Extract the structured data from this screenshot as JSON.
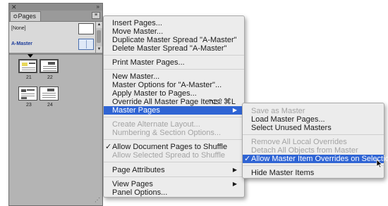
{
  "panel": {
    "tab_label": "≎Pages",
    "close_glyph": "✕",
    "collapse_glyph": "»",
    "menu_glyph": "≡",
    "masters": [
      {
        "label": "[None]"
      },
      {
        "label": "A-Master"
      }
    ],
    "page_numbers": [
      "21",
      "22",
      "23",
      "24"
    ],
    "grip_glyph": "⋰"
  },
  "menu": {
    "items": [
      {
        "label": "Insert Pages...",
        "enabled": true
      },
      {
        "label": "Move Master...",
        "enabled": true
      },
      {
        "label": "Duplicate Master Spread \"A-Master\"",
        "enabled": true
      },
      {
        "label": "Delete Master Spread \"A-Master\"",
        "enabled": true
      },
      {
        "label": "Print Master Pages...",
        "enabled": true
      },
      {
        "label": "New Master...",
        "enabled": true
      },
      {
        "label": "Master Options for \"A-Master\"...",
        "enabled": true
      },
      {
        "label": "Apply Master to Pages...",
        "enabled": true
      },
      {
        "label": "Override All Master Page Items",
        "enabled": true,
        "shortcut": "⌥⇧⌘L"
      },
      {
        "label": "Master Pages",
        "enabled": true,
        "highlighted": true,
        "submenu": true
      },
      {
        "label": "Create Alternate Layout...",
        "enabled": false
      },
      {
        "label": "Numbering & Section Options...",
        "enabled": false
      },
      {
        "label": "Allow Document Pages to Shuffle",
        "enabled": true,
        "checked": true
      },
      {
        "label": "Allow Selected Spread to Shuffle",
        "enabled": false
      },
      {
        "label": "Page Attributes",
        "enabled": true,
        "submenu": true
      },
      {
        "label": "View Pages",
        "enabled": true,
        "submenu": true
      },
      {
        "label": "Panel Options...",
        "enabled": true
      }
    ],
    "check_glyph": "✓",
    "arrow_glyph": "▶"
  },
  "submenu": {
    "items": [
      {
        "label": "Save as Master",
        "enabled": false
      },
      {
        "label": "Load Master Pages...",
        "enabled": true
      },
      {
        "label": "Select Unused Masters",
        "enabled": true
      },
      {
        "label": "Remove All Local Overrides",
        "enabled": false
      },
      {
        "label": "Detach All Objects from Master",
        "enabled": false
      },
      {
        "label": "Allow Master Item Overrides on Selection",
        "enabled": true,
        "checked": true,
        "highlighted": true
      },
      {
        "label": "Hide Master Items",
        "enabled": true
      }
    ]
  },
  "colors": {
    "highlight": "#2f64d4",
    "menu_bg": "#ececec",
    "panel_bg": "#b4b4b4",
    "disabled_text": "#a3a3a3"
  },
  "icons": {
    "cursor": "arrow-cursor-icon",
    "submenu_arrow": "chevron-right-icon",
    "check": "checkmark-icon"
  }
}
